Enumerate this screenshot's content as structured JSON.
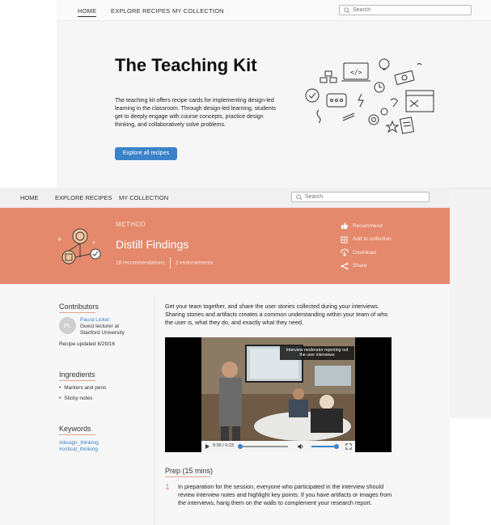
{
  "top_page": {
    "nav": {
      "home": "HOME",
      "explore": "EXPLORE RECIPES",
      "collection": "MY COLLECTION"
    },
    "search_placeholder": "Search",
    "hero": {
      "title": "The Teaching Kit",
      "description": "The teaching kit offers recipe cards for implementing design-led learning in the classroom. Through design-led learning, students get to deeply engage with course concepts, practice design thinking, and collaboratively solve problems.",
      "button": "Explore all recipes"
    }
  },
  "recipe_page": {
    "nav": {
      "home": "HOME",
      "explore": "EXPLORE RECIPES",
      "collection": "MY COLLECTION"
    },
    "search_placeholder": "Search",
    "banner": {
      "kicker": "METHOD",
      "title": "Distill Findings",
      "recommendations": "28 recommendations",
      "endorsements": "2 endorsements",
      "actions": [
        "Recommend",
        "Add to collection",
        "Download",
        "Share"
      ]
    },
    "sidebar": {
      "contributors_heading": "Contributors",
      "avatar_initials": "PL",
      "contributor_name": "Paura Lickel",
      "contributor_role": "Guest lecturer at Stanford University",
      "updated": "Recipe updated 8/29/16",
      "ingredients_heading": "Ingredients",
      "ingredients": [
        "Markers and pens",
        "Sticky notes"
      ],
      "keywords_heading": "Keywords",
      "keywords": [
        "#design_thinking",
        "#critical_thinking"
      ]
    },
    "intro": "Get your team together, and share the user stories collected during your interviews. Sharing stories and artifacts creates a common understanding within your team of who the user is, what they do, and exactly what they need.",
    "video": {
      "caption": "Interview moderator reporting out the user interviews",
      "time": "0:00 / 0:23",
      "progress": 0,
      "volume": 1
    },
    "prep": {
      "heading": "Prep (15 mins)",
      "step_number": "1",
      "step_text": "In preparation for the session, everyone who participated in the interview should review interview notes and highlight key points. If you have artifacts or images from the interviews, hang them on the walls to complement your research report."
    }
  },
  "colors": {
    "accent_blue": "#3b83c9",
    "banner_orange": "#e4896b"
  }
}
